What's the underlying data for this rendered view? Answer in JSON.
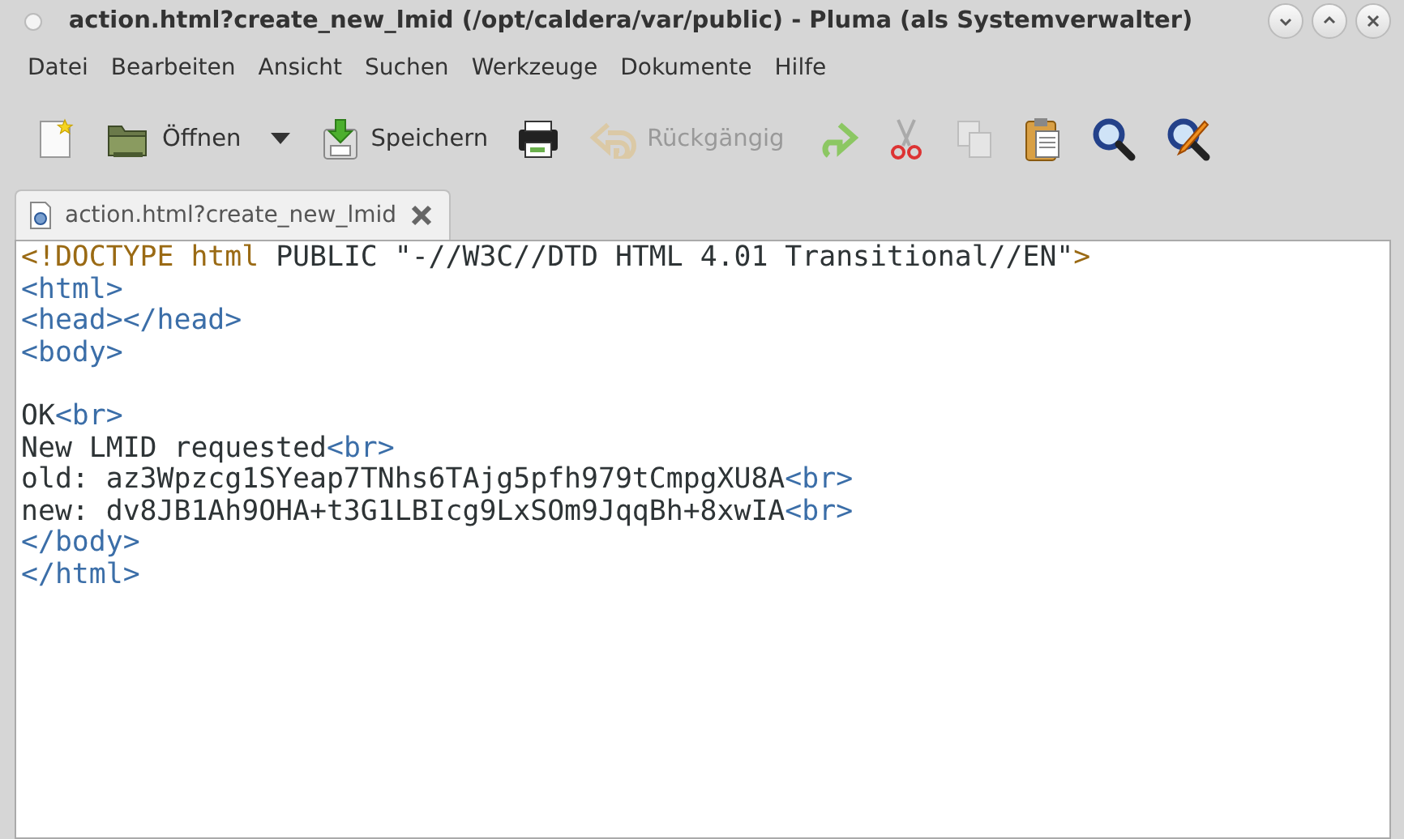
{
  "window": {
    "title": "action.html?create_new_lmid (/opt/caldera/var/public) - Pluma (als Systemverwalter)"
  },
  "menu": [
    "Datei",
    "Bearbeiten",
    "Ansicht",
    "Suchen",
    "Werkzeuge",
    "Dokumente",
    "Hilfe"
  ],
  "toolbar": [
    {
      "kind": "new",
      "disabled": false
    },
    {
      "kind": "open",
      "label": "Öffnen",
      "disabled": false
    },
    {
      "kind": "dropdown",
      "disabled": false
    },
    {
      "kind": "save",
      "label": "Speichern",
      "disabled": false
    },
    {
      "kind": "print",
      "disabled": false
    },
    {
      "kind": "undo",
      "label": "Rückgängig",
      "disabled": true
    },
    {
      "kind": "redo",
      "disabled": false
    },
    {
      "kind": "cut",
      "disabled": false
    },
    {
      "kind": "copy",
      "disabled": true
    },
    {
      "kind": "paste",
      "disabled": false
    },
    {
      "kind": "find",
      "disabled": false
    },
    {
      "kind": "replace",
      "disabled": false
    }
  ],
  "tabs": [
    {
      "label": "action.html?create_new_lmid",
      "selected": true
    }
  ],
  "editor": {
    "lines": [
      {
        "kind": "code",
        "segments": [
          {
            "kind": "doctype",
            "text": "<!DOCTYPE html"
          },
          {
            "kind": "text",
            "text": " PUBLIC \"-//W3C//DTD HTML 4.01 Transitional//EN\""
          },
          {
            "kind": "doctype",
            "text": ">"
          }
        ]
      },
      {
        "kind": "code",
        "segments": [
          {
            "kind": "tag",
            "text": "<html>"
          }
        ]
      },
      {
        "kind": "code",
        "segments": [
          {
            "kind": "tag",
            "text": "<head></head>"
          }
        ]
      },
      {
        "kind": "code",
        "segments": [
          {
            "kind": "tag",
            "text": "<body>"
          }
        ]
      },
      {
        "kind": "blank"
      },
      {
        "kind": "code",
        "segments": [
          {
            "kind": "text",
            "text": "OK"
          },
          {
            "kind": "tag",
            "text": "<br>"
          }
        ]
      },
      {
        "kind": "code",
        "segments": [
          {
            "kind": "text",
            "text": "New LMID requested"
          },
          {
            "kind": "tag",
            "text": "<br>"
          }
        ]
      },
      {
        "kind": "code",
        "segments": [
          {
            "kind": "text",
            "text": "old: az3Wpzcg1SYeap7TNhs6TAjg5pfh979tCmpgXU8A"
          },
          {
            "kind": "tag",
            "text": "<br>"
          }
        ]
      },
      {
        "kind": "code",
        "segments": [
          {
            "kind": "text",
            "text": "new: dv8JB1Ah9OHA+t3G1LBIcg9LxSOm9JqqBh+8xwIA"
          },
          {
            "kind": "tag",
            "text": "<br>"
          }
        ]
      },
      {
        "kind": "code",
        "segments": [
          {
            "kind": "tag",
            "text": "</body>"
          }
        ]
      },
      {
        "kind": "code",
        "segments": [
          {
            "kind": "tag",
            "text": "</html>"
          }
        ]
      }
    ]
  }
}
